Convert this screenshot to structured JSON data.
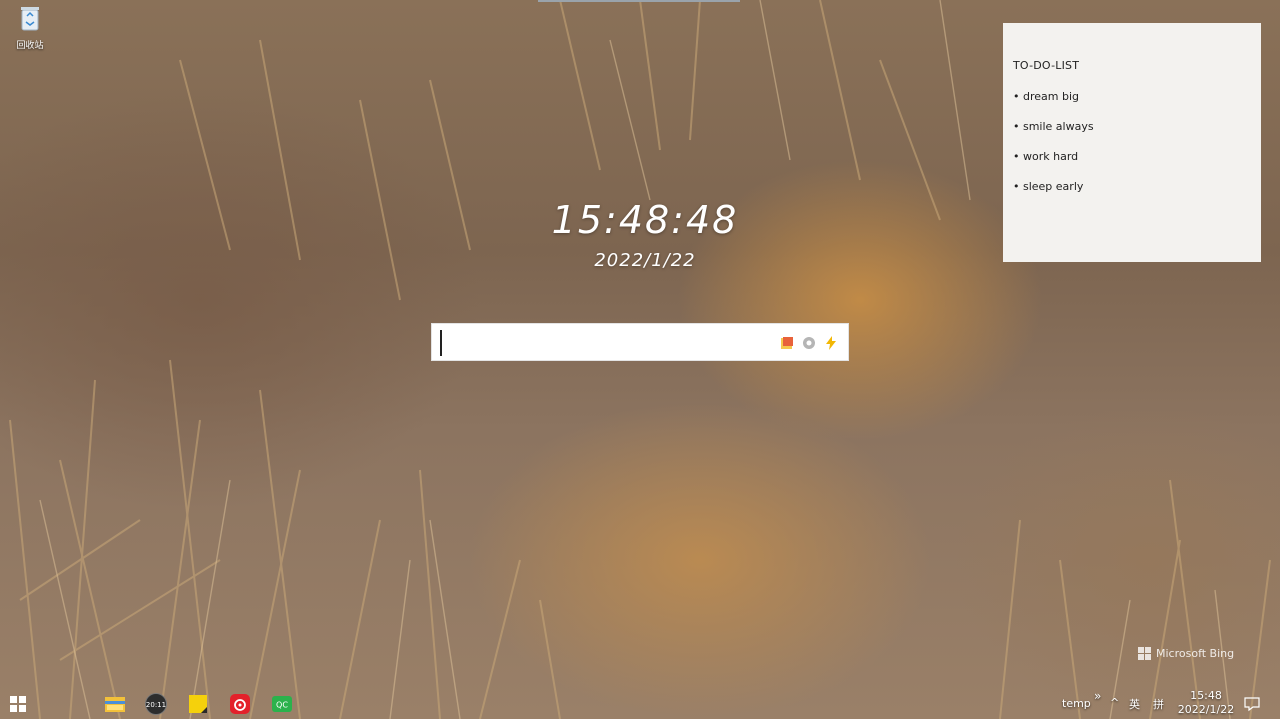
{
  "desktop": {
    "recycle_bin_label": "回收站",
    "background_credit": "Microsoft Bing"
  },
  "clock_widget": {
    "time": "15:48:48",
    "date": "2022/1/22"
  },
  "search_widget": {
    "value": "",
    "tools": [
      "note-icon",
      "settings-icon",
      "lightning-icon"
    ]
  },
  "todo_note": {
    "title": "TO-DO-LIST",
    "items": [
      "• dream big",
      "• smile always",
      "• work hard",
      "• sleep early"
    ]
  },
  "taskbar": {
    "pinned": [
      {
        "icon": "file-explorer-icon"
      },
      {
        "icon": "clock-app-icon",
        "label": "20:11"
      },
      {
        "icon": "sticky-notes-icon"
      },
      {
        "icon": "netease-music-icon"
      },
      {
        "icon": "qc-app-icon",
        "label": "QC"
      }
    ],
    "tray": {
      "toolbar_label": "temp",
      "overflow": "»",
      "chevron": "^",
      "ime_language": "英",
      "ime_mode": "拼",
      "time": "15:48",
      "date": "2022/1/22"
    }
  },
  "colors": {
    "note_bg": "#f3f2ef",
    "netease_red": "#e3212b",
    "qc_green": "#2bb24c",
    "sticky_yellow": "#f5d10c"
  }
}
